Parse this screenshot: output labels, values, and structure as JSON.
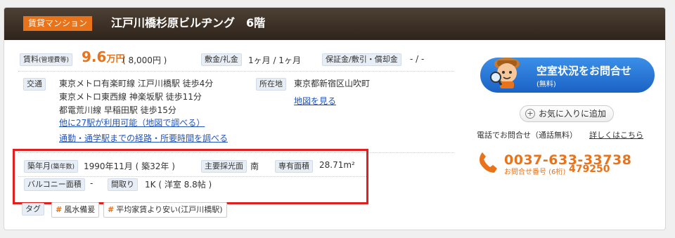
{
  "header": {
    "category": "賃貸マンション",
    "title": "江戸川橋杉原ビルヂング　6階"
  },
  "rent": {
    "label": "賃料",
    "label_sub": "(管理費等)",
    "amount": "9.6",
    "unit": "万円",
    "mgmt_fee": "( 8,000円 )"
  },
  "deposit": {
    "label": "敷金/礼金",
    "value": "1ヶ月 / 1ヶ月"
  },
  "guarantee": {
    "label": "保証金/敷引・償却金",
    "value": "- / -"
  },
  "access": {
    "label": "交通",
    "lines": [
      "東京メトロ有楽町線 江戸川橋駅 徒歩4分",
      "東京メトロ東西線 神楽坂駅 徒歩11分",
      "都電荒川線 早稲田駅 徒歩15分"
    ],
    "more_link": "他に27駅が利用可能（地図で調べる）",
    "route_link": "通勤・通学駅までの経路・所要時間を調べる"
  },
  "address": {
    "label": "所在地",
    "value": "東京都新宿区山吹町",
    "map_link": "地図を見る"
  },
  "built": {
    "label": "築年月",
    "label_sub": "(築年数)",
    "value": "1990年11月 ( 築32年 )"
  },
  "lighting": {
    "label": "主要採光面",
    "value": "南"
  },
  "area": {
    "label": "専有面積",
    "value": "28.71m²"
  },
  "balcony": {
    "label": "バルコニー面積",
    "value": "-"
  },
  "layout": {
    "label": "間取り",
    "value": "1K ( 洋室 8.8帖 )"
  },
  "tags": {
    "label": "タグ",
    "items": [
      "風水備爰",
      "平均家賃より安い(江戸川橋駅)"
    ]
  },
  "contact": {
    "cta_main": "空室状況をお問合せ",
    "cta_sub": "(無料)",
    "favorite": "お気に入りに追加",
    "phone_label": "電話でお問合せ（通話無料）",
    "details_link": "詳しくはこちら",
    "phone_number": "0037-633-33738",
    "inquiry_label": "お問合せ番号 (6桁)",
    "inquiry_number": "479250"
  },
  "colors": {
    "accent": "#e8731a",
    "header_bg": "#3a2e23",
    "highlight_box": "#e0201e",
    "cta_blue": "#2a7bd8"
  }
}
